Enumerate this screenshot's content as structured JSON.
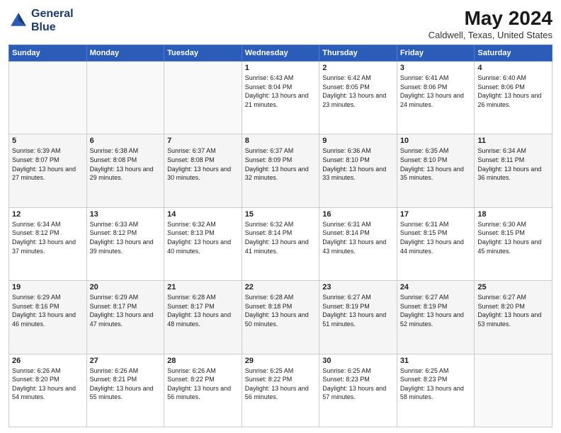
{
  "logo": {
    "line1": "General",
    "line2": "Blue"
  },
  "title": "May 2024",
  "subtitle": "Caldwell, Texas, United States",
  "days_of_week": [
    "Sunday",
    "Monday",
    "Tuesday",
    "Wednesday",
    "Thursday",
    "Friday",
    "Saturday"
  ],
  "weeks": [
    [
      {
        "day": "",
        "sunrise": "",
        "sunset": "",
        "daylight": ""
      },
      {
        "day": "",
        "sunrise": "",
        "sunset": "",
        "daylight": ""
      },
      {
        "day": "",
        "sunrise": "",
        "sunset": "",
        "daylight": ""
      },
      {
        "day": "1",
        "sunrise": "Sunrise: 6:43 AM",
        "sunset": "Sunset: 8:04 PM",
        "daylight": "Daylight: 13 hours and 21 minutes."
      },
      {
        "day": "2",
        "sunrise": "Sunrise: 6:42 AM",
        "sunset": "Sunset: 8:05 PM",
        "daylight": "Daylight: 13 hours and 23 minutes."
      },
      {
        "day": "3",
        "sunrise": "Sunrise: 6:41 AM",
        "sunset": "Sunset: 8:06 PM",
        "daylight": "Daylight: 13 hours and 24 minutes."
      },
      {
        "day": "4",
        "sunrise": "Sunrise: 6:40 AM",
        "sunset": "Sunset: 8:06 PM",
        "daylight": "Daylight: 13 hours and 26 minutes."
      }
    ],
    [
      {
        "day": "5",
        "sunrise": "Sunrise: 6:39 AM",
        "sunset": "Sunset: 8:07 PM",
        "daylight": "Daylight: 13 hours and 27 minutes."
      },
      {
        "day": "6",
        "sunrise": "Sunrise: 6:38 AM",
        "sunset": "Sunset: 8:08 PM",
        "daylight": "Daylight: 13 hours and 29 minutes."
      },
      {
        "day": "7",
        "sunrise": "Sunrise: 6:37 AM",
        "sunset": "Sunset: 8:08 PM",
        "daylight": "Daylight: 13 hours and 30 minutes."
      },
      {
        "day": "8",
        "sunrise": "Sunrise: 6:37 AM",
        "sunset": "Sunset: 8:09 PM",
        "daylight": "Daylight: 13 hours and 32 minutes."
      },
      {
        "day": "9",
        "sunrise": "Sunrise: 6:36 AM",
        "sunset": "Sunset: 8:10 PM",
        "daylight": "Daylight: 13 hours and 33 minutes."
      },
      {
        "day": "10",
        "sunrise": "Sunrise: 6:35 AM",
        "sunset": "Sunset: 8:10 PM",
        "daylight": "Daylight: 13 hours and 35 minutes."
      },
      {
        "day": "11",
        "sunrise": "Sunrise: 6:34 AM",
        "sunset": "Sunset: 8:11 PM",
        "daylight": "Daylight: 13 hours and 36 minutes."
      }
    ],
    [
      {
        "day": "12",
        "sunrise": "Sunrise: 6:34 AM",
        "sunset": "Sunset: 8:12 PM",
        "daylight": "Daylight: 13 hours and 37 minutes."
      },
      {
        "day": "13",
        "sunrise": "Sunrise: 6:33 AM",
        "sunset": "Sunset: 8:12 PM",
        "daylight": "Daylight: 13 hours and 39 minutes."
      },
      {
        "day": "14",
        "sunrise": "Sunrise: 6:32 AM",
        "sunset": "Sunset: 8:13 PM",
        "daylight": "Daylight: 13 hours and 40 minutes."
      },
      {
        "day": "15",
        "sunrise": "Sunrise: 6:32 AM",
        "sunset": "Sunset: 8:14 PM",
        "daylight": "Daylight: 13 hours and 41 minutes."
      },
      {
        "day": "16",
        "sunrise": "Sunrise: 6:31 AM",
        "sunset": "Sunset: 8:14 PM",
        "daylight": "Daylight: 13 hours and 43 minutes."
      },
      {
        "day": "17",
        "sunrise": "Sunrise: 6:31 AM",
        "sunset": "Sunset: 8:15 PM",
        "daylight": "Daylight: 13 hours and 44 minutes."
      },
      {
        "day": "18",
        "sunrise": "Sunrise: 6:30 AM",
        "sunset": "Sunset: 8:15 PM",
        "daylight": "Daylight: 13 hours and 45 minutes."
      }
    ],
    [
      {
        "day": "19",
        "sunrise": "Sunrise: 6:29 AM",
        "sunset": "Sunset: 8:16 PM",
        "daylight": "Daylight: 13 hours and 46 minutes."
      },
      {
        "day": "20",
        "sunrise": "Sunrise: 6:29 AM",
        "sunset": "Sunset: 8:17 PM",
        "daylight": "Daylight: 13 hours and 47 minutes."
      },
      {
        "day": "21",
        "sunrise": "Sunrise: 6:28 AM",
        "sunset": "Sunset: 8:17 PM",
        "daylight": "Daylight: 13 hours and 48 minutes."
      },
      {
        "day": "22",
        "sunrise": "Sunrise: 6:28 AM",
        "sunset": "Sunset: 8:18 PM",
        "daylight": "Daylight: 13 hours and 50 minutes."
      },
      {
        "day": "23",
        "sunrise": "Sunrise: 6:27 AM",
        "sunset": "Sunset: 8:19 PM",
        "daylight": "Daylight: 13 hours and 51 minutes."
      },
      {
        "day": "24",
        "sunrise": "Sunrise: 6:27 AM",
        "sunset": "Sunset: 8:19 PM",
        "daylight": "Daylight: 13 hours and 52 minutes."
      },
      {
        "day": "25",
        "sunrise": "Sunrise: 6:27 AM",
        "sunset": "Sunset: 8:20 PM",
        "daylight": "Daylight: 13 hours and 53 minutes."
      }
    ],
    [
      {
        "day": "26",
        "sunrise": "Sunrise: 6:26 AM",
        "sunset": "Sunset: 8:20 PM",
        "daylight": "Daylight: 13 hours and 54 minutes."
      },
      {
        "day": "27",
        "sunrise": "Sunrise: 6:26 AM",
        "sunset": "Sunset: 8:21 PM",
        "daylight": "Daylight: 13 hours and 55 minutes."
      },
      {
        "day": "28",
        "sunrise": "Sunrise: 6:26 AM",
        "sunset": "Sunset: 8:22 PM",
        "daylight": "Daylight: 13 hours and 56 minutes."
      },
      {
        "day": "29",
        "sunrise": "Sunrise: 6:25 AM",
        "sunset": "Sunset: 8:22 PM",
        "daylight": "Daylight: 13 hours and 56 minutes."
      },
      {
        "day": "30",
        "sunrise": "Sunrise: 6:25 AM",
        "sunset": "Sunset: 8:23 PM",
        "daylight": "Daylight: 13 hours and 57 minutes."
      },
      {
        "day": "31",
        "sunrise": "Sunrise: 6:25 AM",
        "sunset": "Sunset: 8:23 PM",
        "daylight": "Daylight: 13 hours and 58 minutes."
      },
      {
        "day": "",
        "sunrise": "",
        "sunset": "",
        "daylight": ""
      }
    ]
  ]
}
